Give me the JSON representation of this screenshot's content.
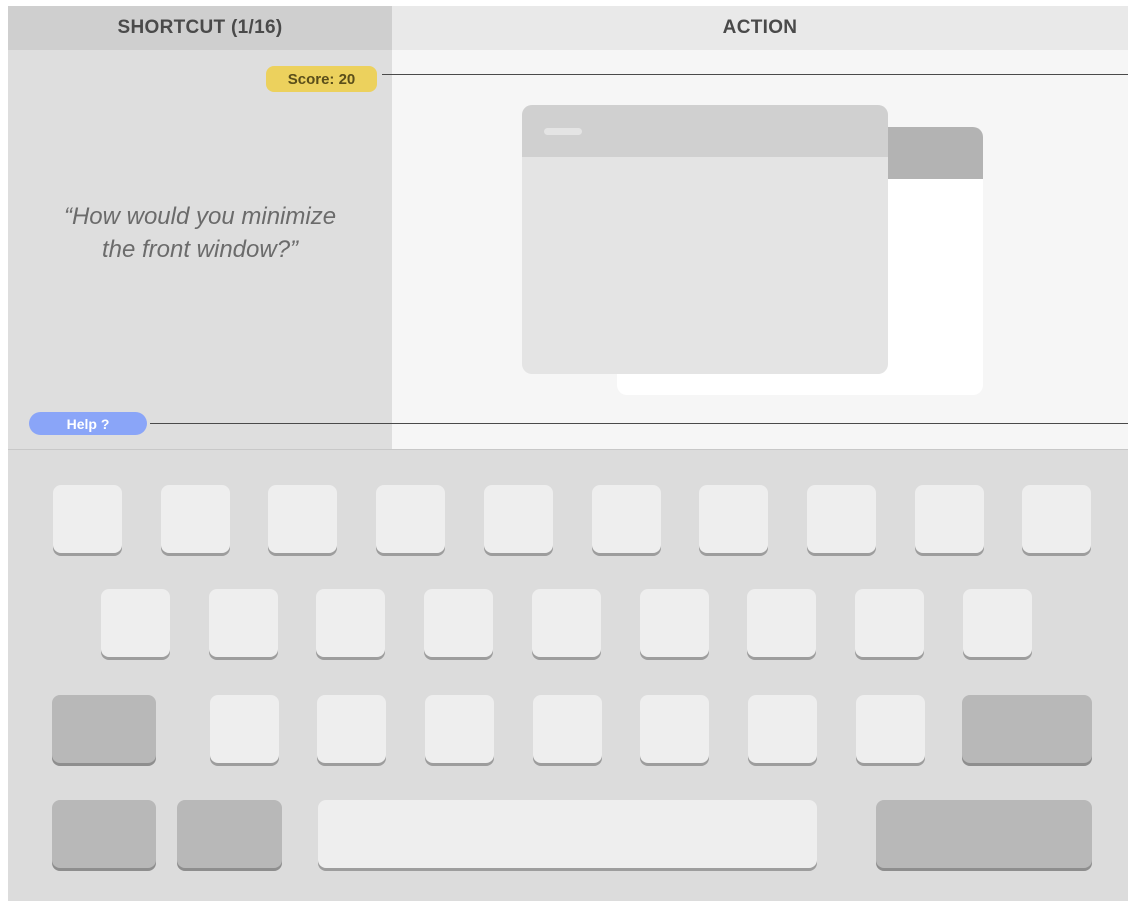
{
  "header": {
    "shortcut_label": "SHORTCUT (1/16)",
    "action_label": "ACTION"
  },
  "score": {
    "label": "Score: 20"
  },
  "question": {
    "line1": "“How would you minimize",
    "line2": "the front window?”"
  },
  "help": {
    "label": "Help  ?"
  },
  "colors": {
    "score_badge": "#ECD15D",
    "help_badge": "#8AA5F8",
    "key_light": "#EEEEEE",
    "key_dark": "#B8B8B8"
  },
  "keyboard": {
    "rows": [
      {
        "keys": [
          "letter",
          "letter",
          "letter",
          "letter",
          "letter",
          "letter",
          "letter",
          "letter",
          "letter",
          "letter"
        ]
      },
      {
        "keys": [
          "letter",
          "letter",
          "letter",
          "letter",
          "letter",
          "letter",
          "letter",
          "letter",
          "letter"
        ]
      },
      {
        "keys": [
          "modifier",
          "letter",
          "letter",
          "letter",
          "letter",
          "letter",
          "letter",
          "letter",
          "modifier"
        ]
      },
      {
        "keys": [
          "modifier",
          "modifier",
          "space",
          "modifier"
        ]
      }
    ]
  }
}
